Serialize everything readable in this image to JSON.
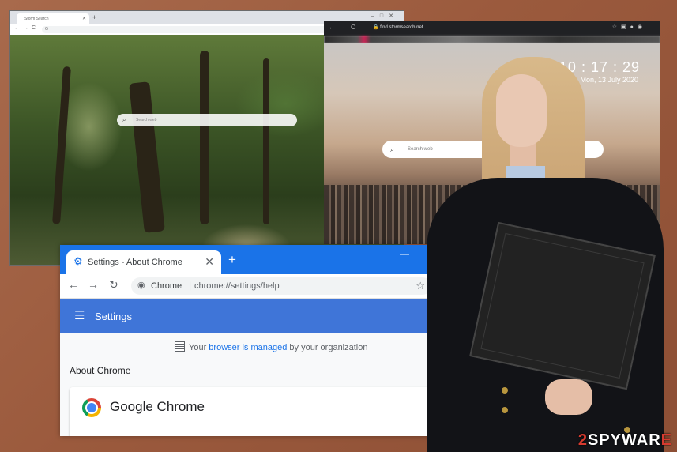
{
  "window1": {
    "tab_title": "Storm Search",
    "address": "G",
    "search_placeholder": "Search web"
  },
  "window2": {
    "url": "find.stormsearch.net",
    "clock": "10 : 17 : 29",
    "date": "Mon, 13 July 2020",
    "search_placeholder": "Search web"
  },
  "settings_window": {
    "tab_title": "Settings - About Chrome",
    "omnibox_site": "Chrome",
    "omnibox_url": "chrome://settings/help",
    "header_title": "Settings",
    "managed_prefix": "Your",
    "managed_link": "browser is managed",
    "managed_suffix": "by your organization",
    "section_title": "About Chrome",
    "product_name": "Google Chrome"
  },
  "watermark": {
    "prefix": "2",
    "suffix": "SPYWAR",
    "end": "E"
  }
}
